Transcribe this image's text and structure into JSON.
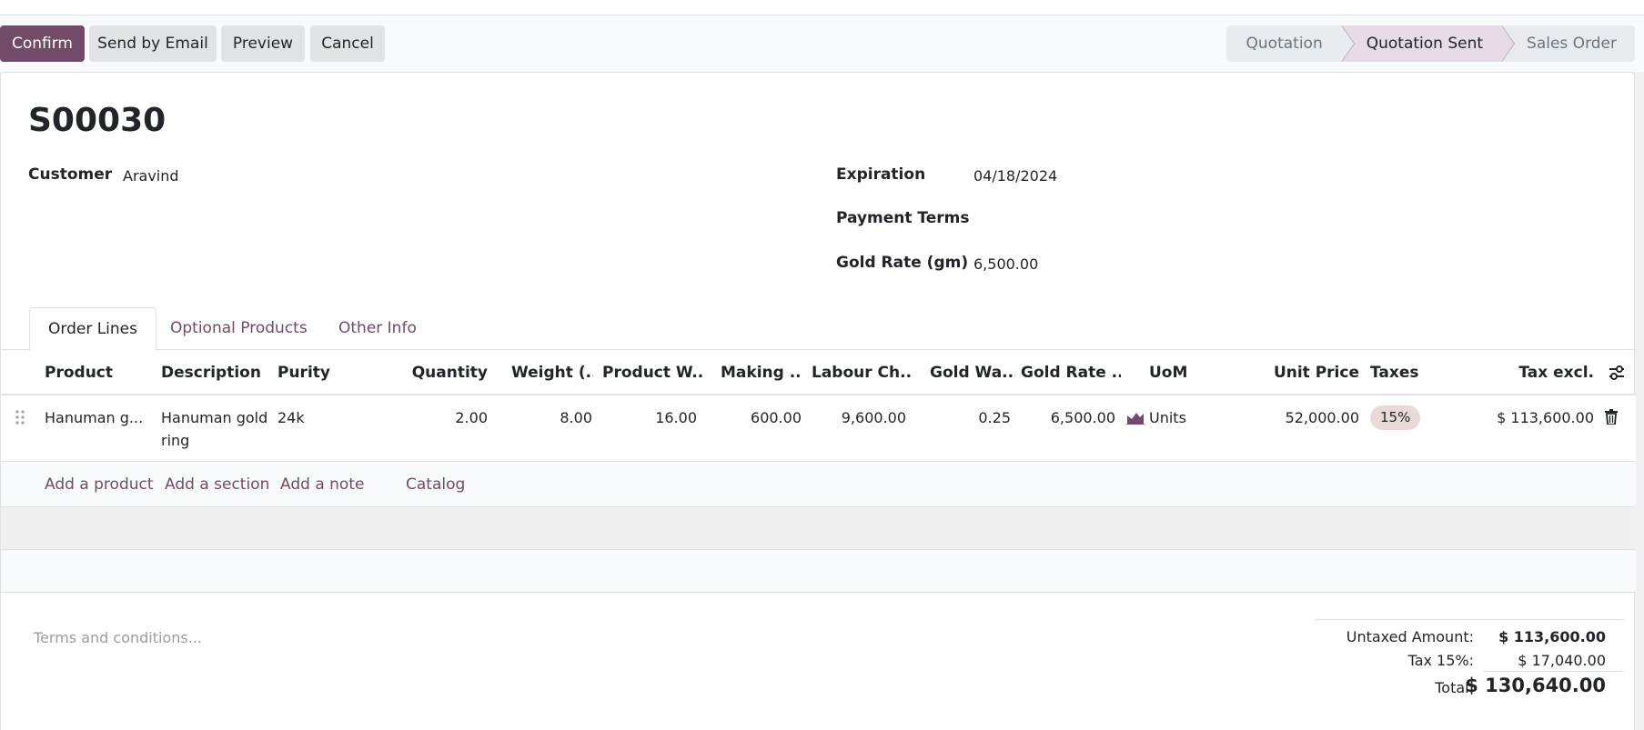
{
  "toolbar": {
    "confirm": "Confirm",
    "send_email": "Send by Email",
    "preview": "Preview",
    "cancel": "Cancel"
  },
  "status_bar": {
    "stages": [
      "Quotation",
      "Quotation Sent",
      "Sales Order"
    ],
    "active": "Quotation Sent"
  },
  "record": {
    "name": "S00030",
    "customer_label": "Customer",
    "customer": "Aravind",
    "expiration_label": "Expiration",
    "expiration": "04/18/2024",
    "payment_terms_label": "Payment Terms",
    "payment_terms": "",
    "gold_rate_label": "Gold Rate (gm)",
    "gold_rate": "6,500.00"
  },
  "tabs": [
    "Order Lines",
    "Optional Products",
    "Other Info"
  ],
  "table": {
    "columns": [
      "Product",
      "Description",
      "Purity",
      "Quantity",
      "Weight (...",
      "Product W...",
      "Making ...",
      "Labour Ch...",
      "Gold Wa...",
      "Gold Rate ...",
      "UoM",
      "Unit Price",
      "Taxes",
      "Tax excl."
    ],
    "rows": [
      {
        "product": "Hanuman g...",
        "description": "Hanuman gold ring",
        "purity": "24k",
        "quantity": "2.00",
        "weight": "8.00",
        "product_weight": "16.00",
        "making": "600.00",
        "labour": "9,600.00",
        "gold_wastage": "0.25",
        "gold_rate": "6,500.00",
        "uom": "Units",
        "unit_price": "52,000.00",
        "taxes": "15%",
        "tax_excl": "$ 113,600.00"
      }
    ],
    "add_links": [
      "Add a product",
      "Add a section",
      "Add a note",
      "Catalog"
    ]
  },
  "terms_placeholder": "Terms and conditions...",
  "totals": {
    "untaxed_label": "Untaxed Amount:",
    "untaxed": "$ 113,600.00",
    "tax_label": "Tax 15%:",
    "tax": "$ 17,040.00",
    "total_label": "Total:",
    "total": "$ 130,640.00"
  },
  "colors": {
    "brand": "#714b67",
    "active_stage": "#e6dbe6",
    "tax_badge": "#ead9d9"
  }
}
